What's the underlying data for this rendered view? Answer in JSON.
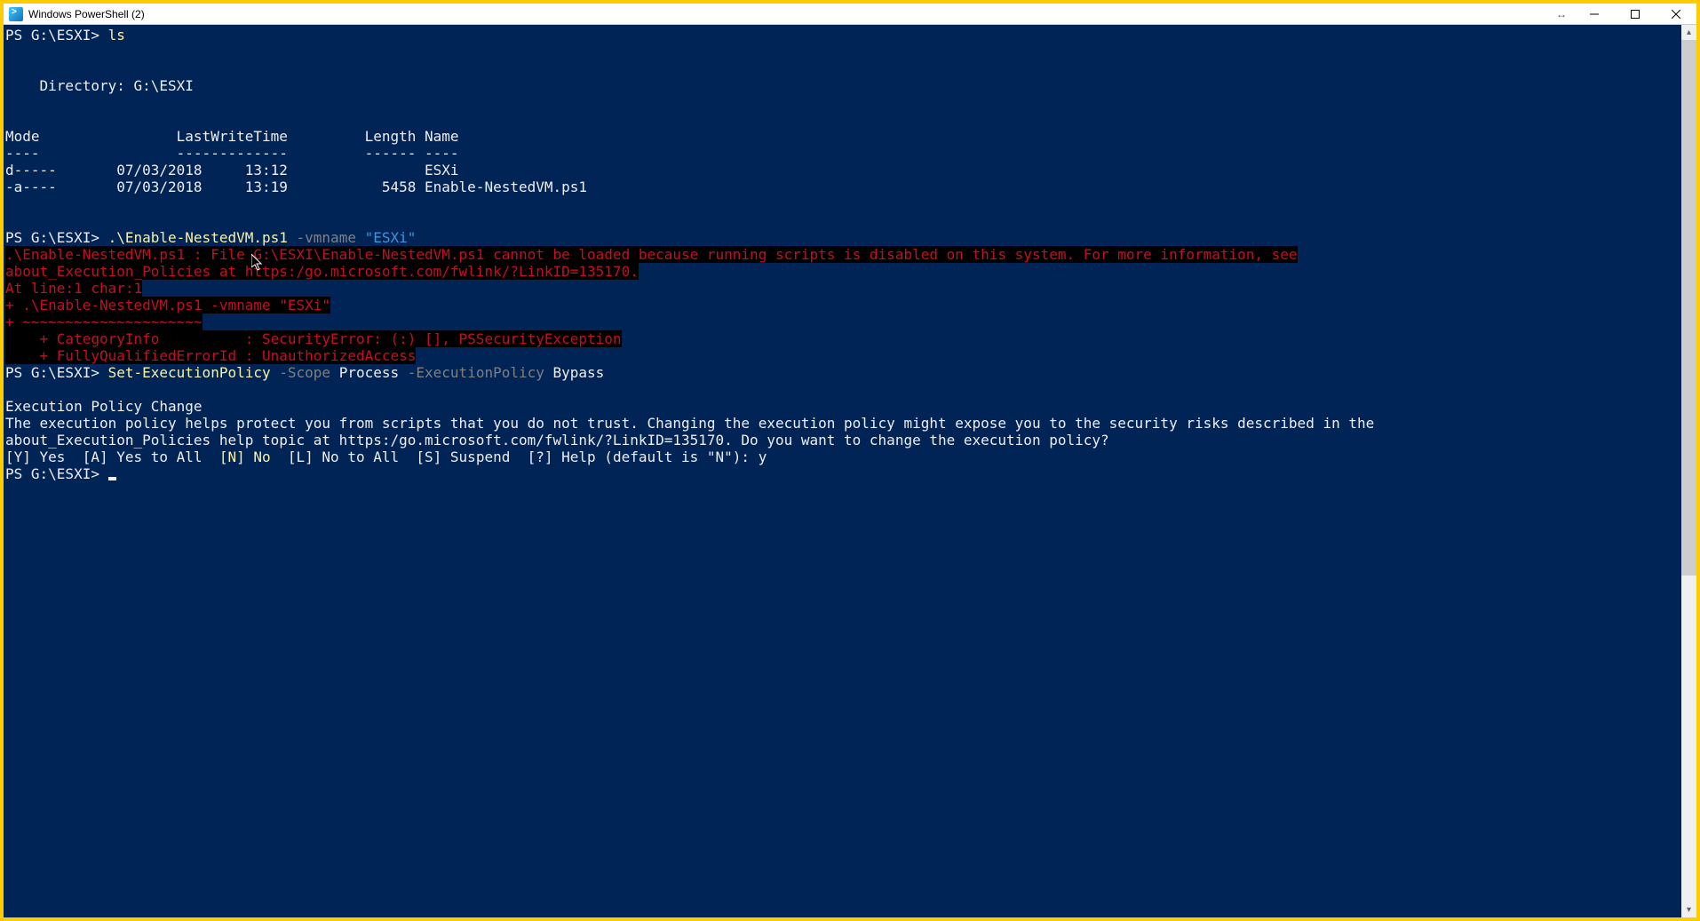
{
  "window": {
    "title": "Windows PowerShell (2)"
  },
  "term": {
    "l0_prompt": "PS G:\\ESXI> ",
    "l0_cmd": "ls",
    "dir_label": "    Directory: G:\\ESXI",
    "hdr": "Mode                LastWriteTime         Length Name",
    "hdr_sep": "----                -------------         ------ ----",
    "row0": "d-----       07/03/2018     13:12                ESXi",
    "row1": "-a----       07/03/2018     13:19           5458 Enable-NestedVM.ps1",
    "l1_prompt": "PS G:\\ESXI> ",
    "l1_cmd": ".\\Enable-NestedVM.ps1",
    "l1_p1": " -vmname ",
    "l1_p2": "\"ESXi\"",
    "err0": ".\\Enable-NestedVM.ps1 : File G:\\ESXI\\Enable-NestedVM.ps1 cannot be loaded because running scripts is disabled on this system. For more information, see",
    "err1": "about_Execution_Policies at https:/go.microsoft.com/fwlink/?LinkID=135170.",
    "err2": "At line:1 char:1",
    "err3": "+ .\\Enable-NestedVM.ps1 -vmname \"ESXi\"",
    "err4": "+ ~~~~~~~~~~~~~~~~~~~~~",
    "err5": "    + CategoryInfo          : SecurityError: (:) [], PSSecurityException",
    "err6": "    + FullyQualifiedErrorId : UnauthorizedAccess",
    "l2_prompt": "PS G:\\ESXI> ",
    "l2_cmd": "Set-ExecutionPolicy",
    "l2_p1": " -Scope ",
    "l2_v1": "Process",
    "l2_p2": " -ExecutionPolicy ",
    "l2_v2": "Bypass",
    "pol0": "Execution Policy Change",
    "pol1": "The execution policy helps protect you from scripts that you do not trust. Changing the execution policy might expose you to the security risks described in the",
    "pol2": "about_Execution_Policies help topic at https:/go.microsoft.com/fwlink/?LinkID=135170. Do you want to change the execution policy?",
    "opt_a": "[Y] Yes  [A] Yes to All  ",
    "opt_b": "[N] No",
    "opt_c": "  [L] No to All  [S] Suspend  [?] Help (default is \"N\"): y",
    "l3_prompt": "PS G:\\ESXI> "
  }
}
